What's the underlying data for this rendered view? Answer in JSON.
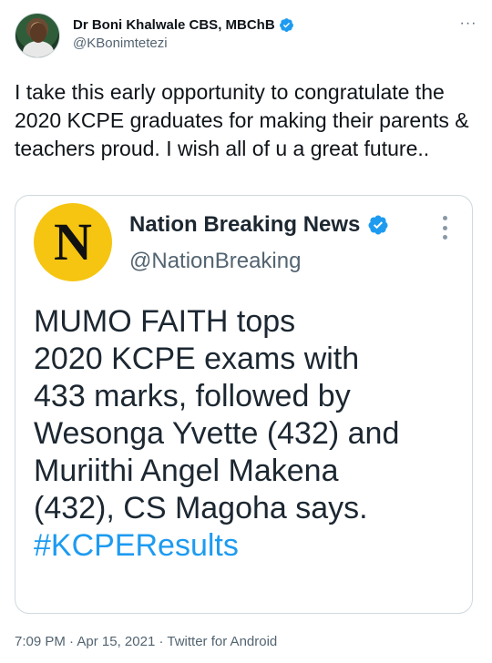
{
  "author": {
    "display_name": "Dr Boni Khalwale CBS, MBChB",
    "handle": "@KBonimtetezi",
    "avatar_icon": "profile-photo",
    "verified_icon": "verified-badge-icon"
  },
  "more_icon": "more-options-icon",
  "tweet": {
    "text": "I take this early opportunity to congratulate the 2020 KCPE graduates for making their parents & teachers proud. I wish all of u a great future.."
  },
  "quoted": {
    "avatar_letter": "N",
    "display_name": "Nation Breaking News",
    "handle": "@NationBreaking",
    "text": "MUMO FAITH tops\n2020 KCPE exams with\n433 marks, followed by\nWesonga Yvette (432) and\nMuriithi Angel Makena\n(432), CS Magoha says.",
    "hashtag": "#KCPEResults"
  },
  "meta": {
    "time": "7:09 PM",
    "date": "Apr 15, 2021",
    "source": "Twitter for Android",
    "separator": "·"
  },
  "colors": {
    "accent": "#1d9bf0",
    "text_primary": "#0f1419",
    "text_secondary": "#536471",
    "nation_yellow": "#f5c511"
  }
}
